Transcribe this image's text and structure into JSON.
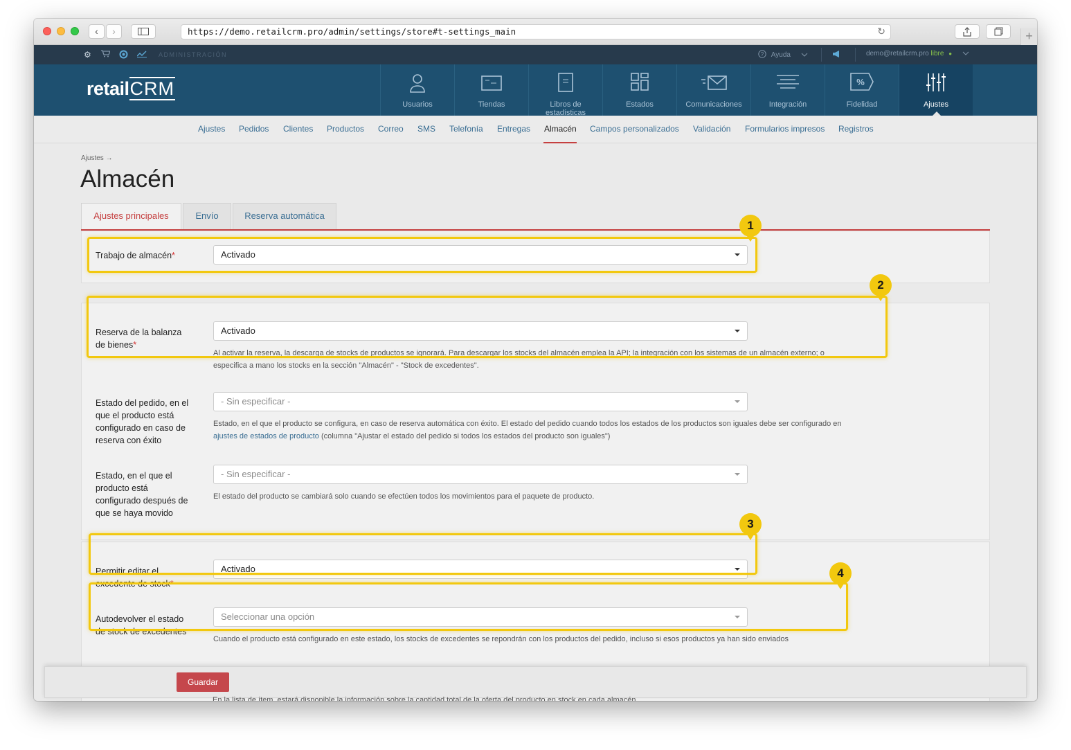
{
  "browser": {
    "url": "https://demo.retailcrm.pro/admin/settings/store#t-settings_main",
    "reload_icon": "↻",
    "back_icon": "‹",
    "forward_icon": "›",
    "new_tab_icon": "+"
  },
  "topbar": {
    "section": "ADMINISTRACIÓN",
    "help": "Ayuda",
    "user_email": "demo@retailcrm.pro",
    "plan": "libre",
    "status_dot": "●"
  },
  "logo": {
    "text_a": "retail",
    "text_b": "CRM"
  },
  "mainnav": {
    "items": [
      {
        "label": "Usuarios",
        "icon": "user-icon"
      },
      {
        "label": "Tiendas",
        "icon": "store-icon"
      },
      {
        "label": "Libros de estadísticas",
        "icon": "book-icon"
      },
      {
        "label": "Estados",
        "icon": "grid-icon"
      },
      {
        "label": "Comunicaciones",
        "icon": "mail-icon"
      },
      {
        "label": "Integración",
        "icon": "integration-icon"
      },
      {
        "label": "Fidelidad",
        "icon": "percent-icon"
      },
      {
        "label": "Ajustes",
        "icon": "sliders-icon"
      }
    ],
    "percent_glyph": "%"
  },
  "subnav": {
    "items": [
      "Ajustes",
      "Pedidos",
      "Clientes",
      "Productos",
      "Correo",
      "SMS",
      "Telefonía",
      "Entregas",
      "Almacén",
      "Campos personalizados",
      "Validación",
      "Formularios impresos",
      "Registros"
    ],
    "active": "Almacén"
  },
  "page": {
    "breadcrumb": "Ajustes →",
    "title": "Almacén",
    "tabs": [
      "Ajustes principales",
      "Envío",
      "Reserva automática"
    ]
  },
  "fields": {
    "warehouse_work": {
      "label": "Trabajo de almacén",
      "required": "*",
      "value": "Activado"
    },
    "reserve_balance": {
      "label_1": "Reserva de la balanza",
      "label_2": "de bienes",
      "required": "*",
      "value": "Activado",
      "help_1": "Al activar la reserva, la descarga de stocks de productos se ignorará. Para descargar los stocks del almacén emplea la API; la integración con los sistemas de un almacén externo; o",
      "help_2": "especifica a mano los stocks en la sección \"Almacén\" - \"Stock de excedentes\"."
    },
    "order_status": {
      "label_1": "Estado del pedido, en el",
      "label_2": "que el producto está",
      "label_3": "configurado en caso de",
      "label_4": "reserva con éxito",
      "value": "- Sin especificar -",
      "help_1": "Estado, en el que el producto se configura, en caso de reserva automática con éxito. El estado del pedido cuando todos los estados de los productos son iguales debe ser configurado en",
      "help_link": "ajustes de estados de producto",
      "help_2": " (columna \"Ajustar el estado del pedido si todos los estados del producto son iguales\")"
    },
    "moved_status": {
      "label_1": "Estado, en el que el",
      "label_2": "producto está",
      "label_3": "configurado después de",
      "label_4": "que se haya movido",
      "value": "- Sin especificar -",
      "help": "El estado del producto se cambiará solo cuando se efectúen todos los movimientos para el paquete de producto."
    },
    "edit_surplus": {
      "label_1": "Permitir editar el",
      "label_2": "excedente de stock",
      "required": "*",
      "value": "Activado"
    },
    "auto_return": {
      "label_1": "Autodevolver el estado",
      "label_2": "de stock de excedentes",
      "value": "Seleccionar una opción",
      "help": "Cuando el producto está configurado en este estado, los stocks de excedentes se repondrán con los productos del pedido, incluso si esos productos ya han sido enviados"
    }
  },
  "badges": [
    "1",
    "2",
    "3",
    "4"
  ],
  "footer": {
    "save": "Guardar",
    "under_text": "En la lista de ítem, estará disponible la información sobre la cantidad total de la oferta del producto en stock en cada almacén"
  },
  "colors": {
    "highlight": "#f2c80f",
    "accent": "#c54040",
    "nav": "#1e5070",
    "link": "#3a6e93"
  }
}
